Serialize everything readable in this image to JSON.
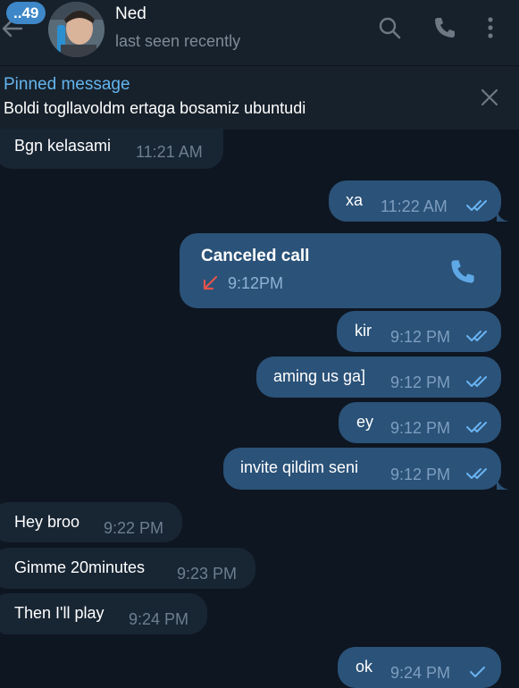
{
  "header": {
    "unread_count": "..49",
    "contact_name": "Ned",
    "status": "last seen recently"
  },
  "pinned": {
    "title": "Pinned message",
    "text": "Boldi togllavoldm ertaga bosamiz ubuntudi"
  },
  "messages": [
    {
      "dir": "in",
      "text": "Bgn kelasami",
      "time": "11:21 AM"
    },
    {
      "dir": "out",
      "text": "xa",
      "time": "11:22 AM",
      "status": "read"
    },
    {
      "dir": "out",
      "type": "call",
      "text": "Canceled call",
      "time": "9:12PM"
    },
    {
      "dir": "out",
      "text": "kir",
      "time": "9:12 PM",
      "status": "read"
    },
    {
      "dir": "out",
      "text": "aming us ga]",
      "time": "9:12 PM",
      "status": "read"
    },
    {
      "dir": "out",
      "text": "ey",
      "time": "9:12 PM",
      "status": "read"
    },
    {
      "dir": "out",
      "text": "invite qildim seni",
      "time": "9:12 PM",
      "status": "read"
    },
    {
      "dir": "in",
      "text": "Hey broo",
      "time": "9:22 PM"
    },
    {
      "dir": "in",
      "text": "Gimme 20minutes",
      "time": "9:23 PM"
    },
    {
      "dir": "in",
      "text": "Then I'll play",
      "time": "9:24 PM"
    },
    {
      "dir": "out",
      "text": "ok",
      "time": "9:24 PM",
      "status": "sent"
    }
  ],
  "icons": {
    "back": "arrow-left-icon",
    "search": "search-icon",
    "call": "phone-icon",
    "menu": "more-vertical-icon",
    "close_pinned": "close-icon",
    "missed_call": "missed-call-arrow-icon"
  },
  "colors": {
    "background": "#0e1621",
    "header": "#17212b",
    "incoming_bubble": "#182533",
    "outgoing_bubble": "#2b5278",
    "accent": "#64b5ef",
    "badge": "#3e87c8",
    "missed_call": "#e5534b"
  }
}
